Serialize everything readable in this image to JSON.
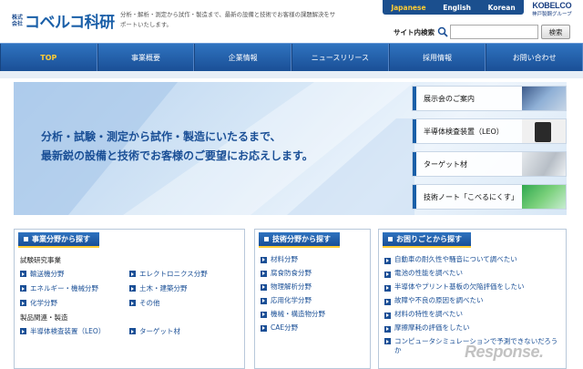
{
  "header": {
    "logo_mark_top": "株式",
    "logo_mark_bottom": "会社",
    "logo_text": "コベルコ科研",
    "tagline": "分析・解析・測定から試作・製造まで、最新の設備と技術でお客様の課題解決をサポートいたします。",
    "languages": [
      "Japanese",
      "English",
      "Korean"
    ],
    "active_language": "Japanese",
    "brand": "KOBELCO",
    "brand_sub": "神戸製鋼グループ",
    "search_label": "サイト内検索",
    "search_value": "",
    "search_button": "検索"
  },
  "nav": {
    "items": [
      "TOP",
      "事業概要",
      "企業情報",
      "ニュースリリース",
      "採用情報",
      "お問い合わせ"
    ]
  },
  "hero": {
    "line1": "分析・試験・測定から試作・製造にいたるまで、",
    "line2": "最新鋭の設備と技術でお客様のご要望にお応えします。",
    "side_items": [
      "展示会のご案内",
      "半導体検査装置（LEO）",
      "ターゲット材",
      "技術ノート「こべるにくす」"
    ]
  },
  "panel_business": {
    "title": "事業分野から探す",
    "section1": "試験研究事業",
    "section1_links": [
      "輸送機分野",
      "エレクトロニクス分野",
      "エネルギー・機械分野",
      "土木・建築分野",
      "化学分野",
      "その他"
    ],
    "section2": "製品関連・製造",
    "section2_links": [
      "半導体検査装置（LEO）",
      "ターゲット材"
    ]
  },
  "panel_tech": {
    "title": "技術分野から探す",
    "links": [
      "材料分野",
      "腐食防食分野",
      "物理解析分野",
      "応用化学分野",
      "機械・構造物分野",
      "CAE分野"
    ]
  },
  "panel_trouble": {
    "title": "お困りごとから探す",
    "links": [
      "自動車の耐久性や騒音について調べたい",
      "電池の性能を調べたい",
      "半導体やプリント基板の欠陥評価をしたい",
      "故障や不良の原因を調べたい",
      "材料の特性を調べたい",
      "摩擦摩耗の評価をしたい",
      "コンピュータシミュレーションで予測できないだろうか"
    ]
  },
  "watermark": "Response.",
  "colors": {
    "brand_blue": "#1a4f96",
    "accent_yellow": "#ffcc33"
  }
}
